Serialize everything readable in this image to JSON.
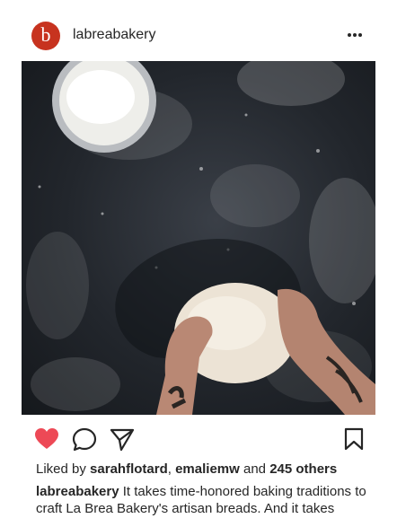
{
  "post": {
    "avatar_letter": "b",
    "username": "labreabakery",
    "liked_by_prefix": "Liked by",
    "liked_user_1": "sarahflotard",
    "liked_user_2": "emaliemw",
    "liked_and": "and",
    "liked_others": "245 others",
    "caption_user": "labreabakery",
    "caption_text": "It takes time-honored baking traditions to craft La Brea Bakery's artisan breads. And it takes"
  },
  "icons": {
    "more": "more-options-icon",
    "like": "heart-icon",
    "comment": "comment-icon",
    "share": "send-icon",
    "save": "bookmark-icon"
  },
  "colors": {
    "avatar": "#c7331f",
    "like": "#ed4956",
    "text": "#262626"
  }
}
